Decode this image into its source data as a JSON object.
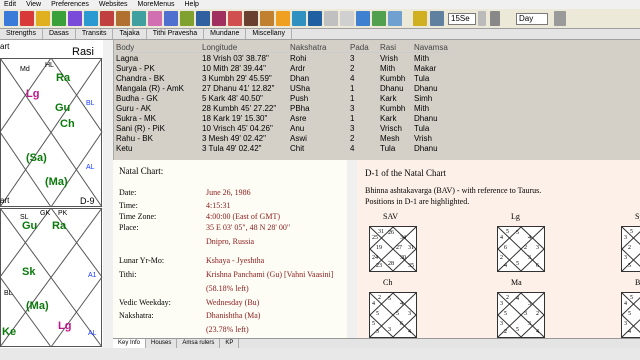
{
  "menubar": [
    "Edit",
    "View",
    "Preferences",
    "Websites",
    "MoreMenus",
    "Help"
  ],
  "toolbar": {
    "zoom_select": "15Se",
    "period_select": "Day"
  },
  "tabs": [
    "Strengths",
    "Dasas",
    "Transits",
    "Tajaka",
    "Tithi Pravesha",
    "Mundane",
    "Miscellany"
  ],
  "left_charts": {
    "top_fragment": "art",
    "rasi_label": "Rasi",
    "d9_label": "D-9",
    "bottom_fragment": "art",
    "rasi_items": [
      {
        "t": "Md",
        "c": "#000",
        "big": false
      },
      {
        "t": "HL",
        "c": "#000",
        "big": false
      },
      {
        "t": "Ra",
        "c": "#0a7a0a",
        "big": true
      },
      {
        "t": "Lg",
        "c": "#c0148c",
        "big": true
      },
      {
        "t": "Gu",
        "c": "#0a7a0a",
        "big": true
      },
      {
        "t": "Ch",
        "c": "#0a7a0a",
        "big": true
      },
      {
        "t": "(Sa)",
        "c": "#0a7a0a",
        "big": true
      },
      {
        "t": "(Ma)",
        "c": "#0a7a0a",
        "big": true
      },
      {
        "t": "BL",
        "c": "#1a3cff",
        "big": false
      },
      {
        "t": "AL",
        "c": "#1a3cff",
        "big": false
      }
    ],
    "d9_items": [
      {
        "t": "Gu",
        "c": "#0a7a0a",
        "big": true
      },
      {
        "t": "Ra",
        "c": "#0a7a0a",
        "big": true
      },
      {
        "t": "Sk",
        "c": "#0a7a0a",
        "big": true
      },
      {
        "t": "(Ma)",
        "c": "#0a7a0a",
        "big": true
      },
      {
        "t": "Ke",
        "c": "#0a7a0a",
        "big": true
      },
      {
        "t": "Lg",
        "c": "#c0148c",
        "big": true
      },
      {
        "t": "SL",
        "c": "#000",
        "big": false
      },
      {
        "t": "GK",
        "c": "#000",
        "big": false
      },
      {
        "t": "PK",
        "c": "#000",
        "big": false
      },
      {
        "t": "A1",
        "c": "#1a3cff",
        "big": false
      },
      {
        "t": "BL",
        "c": "#000",
        "big": false
      },
      {
        "t": "AL",
        "c": "#1a3cff",
        "big": false
      }
    ]
  },
  "planet_table": {
    "headers": [
      "Body",
      "Longitude",
      "Nakshatra",
      "Pada",
      "Rasi",
      "Navamsa"
    ],
    "rows": [
      [
        "Lagna",
        "18 Vrish 03' 38.78\"",
        "Rohi",
        "3",
        "Vrish",
        "Mith"
      ],
      [
        "Surya - PK",
        "10 Mith 28' 39.44\"",
        "Ardr",
        "2",
        "Mith",
        "Makar"
      ],
      [
        "Chandra - BK",
        "3 Kumbh 29' 45.59\"",
        "Dhan",
        "4",
        "Kumbh",
        "Tula"
      ],
      [
        "Mangala (R) - AmK",
        "27 Dhanu 41' 12.82\"",
        "USha",
        "1",
        "Dhanu",
        "Dhanu"
      ],
      [
        "Budha - GK",
        "5 Kark 48' 40.50\"",
        "Push",
        "1",
        "Kark",
        "Simh"
      ],
      [
        "Guru - AK",
        "28 Kumbh 45' 27.22\"",
        "PBha",
        "3",
        "Kumbh",
        "Mith"
      ],
      [
        "Sukra - MK",
        "18 Kark 19' 15.30\"",
        "Asre",
        "1",
        "Kark",
        "Dhanu"
      ],
      [
        "Sani (R) - PiK",
        "10 Vrisch 45' 04.26\"",
        "Anu",
        "3",
        "Vrisch",
        "Tula"
      ],
      [
        "Rahu - BK",
        "3 Mesh 49' 02.42\"",
        "Aswi",
        "2",
        "Mesh",
        "Vrish"
      ],
      [
        "Ketu",
        "3 Tula 49' 02.42\"",
        "Chit",
        "4",
        "Tula",
        "Dhanu"
      ]
    ]
  },
  "natal": {
    "title": "Natal Chart:",
    "rows": [
      {
        "k": "Date:",
        "v": "June 26, 1986"
      },
      {
        "k": "Time:",
        "v": "4:15:31"
      },
      {
        "k": "Time Zone:",
        "v": "4:00:00 (East of GMT)"
      },
      {
        "k": "Place:",
        "v": "35 E 03' 05\", 48 N 28' 00\""
      },
      {
        "k": "",
        "v": "Dnipro, Russia"
      },
      {
        "k": "Lunar Yr-Mo:",
        "v": "Kshaya - Jyeshtha"
      },
      {
        "k": "Tithi:",
        "v": "Krishna Panchami (Gu) [Vahni Vaasini]"
      },
      {
        "k": "",
        "v": "(58.18% left)"
      },
      {
        "k": "Vedic Weekday:",
        "v": "Wednesday (Bu)"
      },
      {
        "k": "Nakshatra:",
        "v": "Dhanishtha (Ma)"
      },
      {
        "k": "",
        "v": "(23.78% left)"
      }
    ]
  },
  "bav": {
    "title": "D-1 of the Natal Chart",
    "desc1": "Bhinna ashtakavarga (BAV) - with reference to Taurus.",
    "desc2": "Positions in D-1 are highlighted.",
    "charts": [
      {
        "label": "SAV",
        "nums": [
          "26",
          "34",
          "31",
          "30",
          "35",
          "28",
          "23",
          "24",
          "19",
          "25",
          "31",
          "27"
        ]
      },
      {
        "label": "Lg",
        "nums": [
          "5",
          "4",
          "3",
          "3",
          "6",
          "5",
          "4",
          "2",
          "6",
          "4",
          "5",
          "2"
        ]
      },
      {
        "label": "Sy",
        "nums": [
          "6",
          "5",
          "4",
          "3",
          "4",
          "4",
          "5",
          "3",
          "2",
          "3",
          "5",
          "4"
        ]
      },
      {
        "label": "Ch",
        "nums": [
          "5",
          "4",
          "3",
          "6",
          "4",
          "3",
          "3",
          "5",
          "5",
          "4",
          "2",
          "5"
        ]
      },
      {
        "label": "Ma",
        "nums": [
          "4",
          "3",
          "2",
          "3",
          "4",
          "5",
          "2",
          "3",
          "5",
          "3",
          "2",
          "3"
        ]
      },
      {
        "label": "Bu",
        "nums": [
          "5",
          "4",
          "3",
          "5",
          "6",
          "4",
          "4",
          "3",
          "5",
          "4",
          "5",
          "4"
        ]
      }
    ]
  },
  "bottom_tabs": [
    "Key Info",
    "Houses",
    "Amsa rulers",
    "KP"
  ],
  "colors": {
    "natal_value": "#8b1a1a",
    "rasi_green": "#0a7a0a",
    "lagna_pink": "#c0148c",
    "ascendant_blue": "#1a3cff"
  }
}
